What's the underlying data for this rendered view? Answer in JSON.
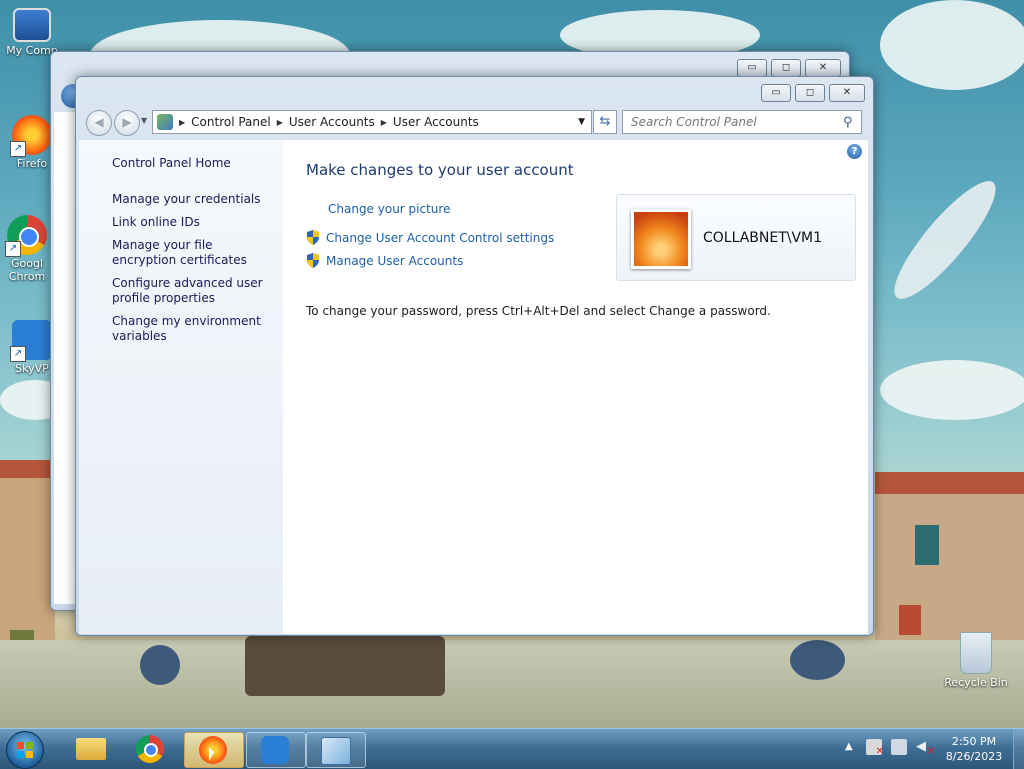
{
  "desktop": {
    "icons": [
      {
        "label": "My Comp",
        "icon": "computer-icon"
      },
      {
        "label": "Firefo",
        "icon": "firefox-icon"
      },
      {
        "label": "Googl Chrom",
        "icon": "chrome-icon"
      },
      {
        "label": "SkyVP",
        "icon": "skyvpn-icon"
      },
      {
        "label": "Recycle Bin",
        "icon": "recycle-bin-icon"
      }
    ]
  },
  "back_window": {
    "buttons": {
      "minimize": "▭",
      "maximize": "◻",
      "close": "✕"
    }
  },
  "window": {
    "caption_buttons": {
      "minimize": "▭",
      "maximize": "◻",
      "close": "✕"
    },
    "address": {
      "crumbs": [
        "Control Panel",
        "User Accounts",
        "User Accounts"
      ]
    },
    "search": {
      "placeholder": "Search Control Panel"
    },
    "left_pane": {
      "home": "Control Panel Home",
      "links": [
        "Manage your credentials",
        "Link online IDs",
        "Manage your file encryption certificates",
        "Configure advanced user profile properties",
        "Change my environment variables"
      ]
    },
    "main": {
      "title": "Make changes to your user account",
      "links": {
        "change_picture": "Change your picture",
        "uac_settings": "Change User Account Control settings",
        "manage_accounts": "Manage User Accounts"
      },
      "account_name": "COLLABNET\\VM1",
      "password_note": "To change your password, press Ctrl+Alt+Del and select Change a password.",
      "help": "?"
    }
  },
  "taskbar": {
    "start": "start-orb-icon",
    "pinned": [
      "file-explorer-icon",
      "chrome-icon",
      "firefox-icon",
      "skyvpn-icon",
      "control-panel-icon"
    ],
    "clock": {
      "time": "2:50 PM",
      "date": "8/26/2023"
    }
  },
  "colors": {
    "link": "#1e5fa8",
    "title": "#1e3c6e",
    "taskbar": "#2c5678"
  }
}
